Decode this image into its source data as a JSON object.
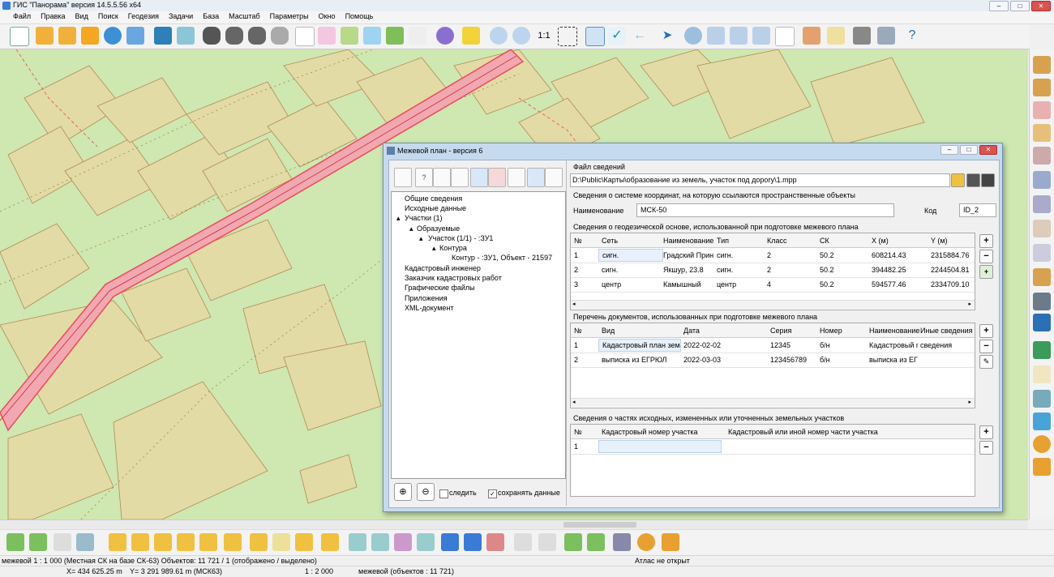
{
  "app": {
    "title": "ГИС \"Панорама\" версия 14.5.5.56 x64"
  },
  "menu": [
    "Файл",
    "Правка",
    "Вид",
    "Поиск",
    "Геодезия",
    "Задачи",
    "База",
    "Масштаб",
    "Параметры",
    "Окно",
    "Помощь"
  ],
  "toolbar": {
    "scale_label": "1:1"
  },
  "dialog": {
    "title": "Межевой план - версия 6",
    "tree": [
      {
        "label": "Общие сведения"
      },
      {
        "label": "Исходные данные"
      },
      {
        "label": "Участки (1)"
      },
      {
        "label": "Образуемые"
      },
      {
        "label": "Участок (1/1) - :ЗУ1"
      },
      {
        "label": "Контура"
      },
      {
        "label": "Контур - :ЗУ1, Объект - 21597"
      },
      {
        "label": "Кадастровый инженер"
      },
      {
        "label": "Заказчик кадастровых работ"
      },
      {
        "label": "Графические файлы"
      },
      {
        "label": "Приложения"
      },
      {
        "label": "XML-документ"
      }
    ],
    "footer": {
      "follow_label": "следить",
      "save_label": "сохранять данные"
    },
    "file_section": {
      "title": "Файл сведений",
      "path": "D:\\Public\\Карты\\образование из земель, участок под дорогу\\1.mpp"
    },
    "coord_section": {
      "title": "Сведения о системе координат, на которую ссылаются пространственные объекты",
      "name_label": "Наименование",
      "name_value": "МСК-50",
      "code_label": "Код",
      "code_value": "ID_2"
    },
    "geodetic": {
      "title": "Сведения о геодезической основе, использованной при подготовке межевого плана",
      "columns": [
        "№",
        "Сеть",
        "Наименование",
        "Тип",
        "Класс",
        "СК",
        "X (м)",
        "Y (м)"
      ],
      "rows": [
        [
          "1",
          "сигн.",
          "Градский Прин",
          "сигн.",
          "2",
          "50.2",
          "608214.43",
          "2315884.76"
        ],
        [
          "2",
          "сигн.",
          "Якшур, 23.8",
          "сигн.",
          "2",
          "50.2",
          "394482.25",
          "2244504.81"
        ],
        [
          "3",
          "центр",
          "Камышный",
          "центр",
          "4",
          "50.2",
          "594577.46",
          "2334709.10"
        ]
      ]
    },
    "documents": {
      "title": "Перечень документов, использованных при подготовке межевого плана",
      "columns": [
        "№",
        "Вид",
        "Дата",
        "Серия",
        "Номер",
        "Наименование",
        "Иные сведения"
      ],
      "rows": [
        [
          "1",
          "Кадастровый план земе",
          "2022-02-02",
          "12345",
          "б/н",
          "Кадастровый г",
          "сведения"
        ],
        [
          "2",
          "выписка из ЕГРЮЛ",
          "2022-03-03",
          "123456789",
          "б/н",
          "выписка из ЕГ",
          ""
        ]
      ]
    },
    "parts": {
      "title": "Сведения о частях исходных, измененных или уточненных земельных участков",
      "columns": [
        "№",
        "Кадастровый номер участка",
        "Кадастровый или иной номер части участка"
      ],
      "rows": [
        [
          "1",
          "",
          ""
        ]
      ]
    }
  },
  "status": {
    "layer_info": "межевой 1 : 1 000 (Местная СК на базе СК-63) Объектов: 11 721 / 1 (отображено / выделено)",
    "atlas": "Атлас не открыт",
    "x": "X=   434 625.25 m",
    "y": "Y= 3 291 989.61 m  (МСК63)",
    "scale": "1 : 2 000",
    "map_name": "межевой   (объектов : 11 721)"
  },
  "colors": {
    "map_background": "#cfe7b1",
    "parcel_fill": "#e3dba5",
    "road_red": "#e84b5a",
    "dialog_frame": "#c6daef"
  }
}
